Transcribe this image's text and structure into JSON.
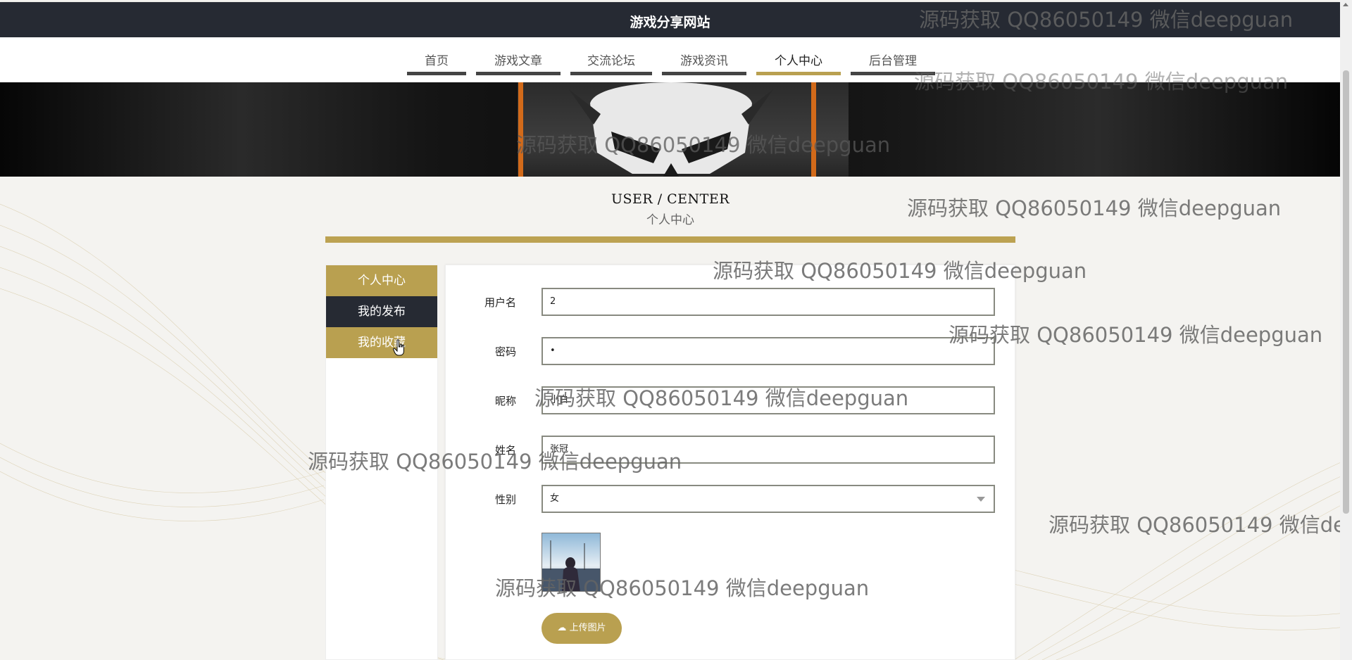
{
  "header": {
    "site_title": "游戏分享网站"
  },
  "nav": {
    "items": [
      {
        "label": "首页"
      },
      {
        "label": "游戏文章"
      },
      {
        "label": "交流论坛"
      },
      {
        "label": "游戏资讯"
      },
      {
        "label": "个人中心",
        "active": true
      },
      {
        "label": "后台管理"
      }
    ]
  },
  "section": {
    "title_en": "USER / CENTER",
    "title_cn": "个人中心"
  },
  "sidebar": {
    "items": [
      {
        "label": "个人中心"
      },
      {
        "label": "我的发布"
      },
      {
        "label": "我的收藏"
      }
    ]
  },
  "form": {
    "username": {
      "label": "用户名",
      "value": "2"
    },
    "password": {
      "label": "密码",
      "value": "•"
    },
    "nickname": {
      "label": "昵称",
      "value": "小白"
    },
    "realname": {
      "label": "姓名",
      "value": "张冠"
    },
    "gender": {
      "label": "性别",
      "value": "女"
    },
    "upload_label": "上传图片"
  },
  "watermark": "源码获取 QQ86050149 微信deepguan",
  "colors": {
    "gold": "#b9a050",
    "dark": "#262a33"
  }
}
